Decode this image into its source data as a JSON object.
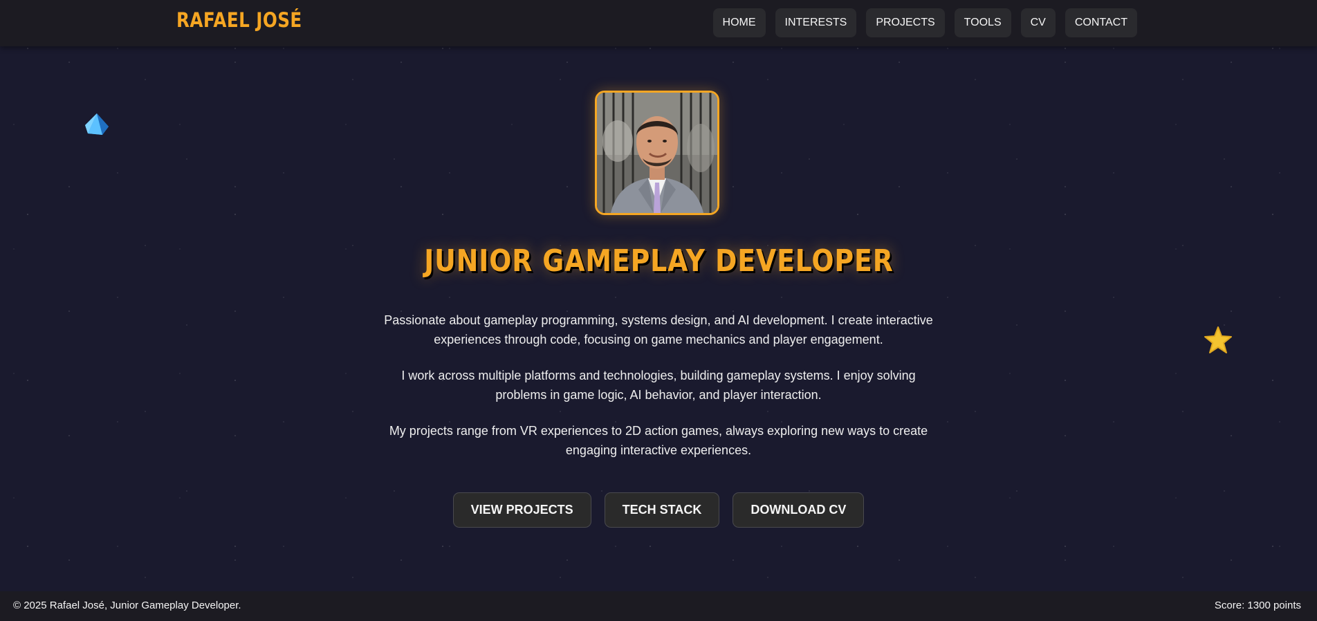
{
  "header": {
    "logo": "RAFAEL JOSÉ",
    "nav": [
      "HOME",
      "INTERESTS",
      "PROJECTS",
      "TOOLS",
      "CV",
      "CONTACT"
    ]
  },
  "hero": {
    "photo_icon": "profile-photo",
    "title": "JUNIOR GAMEPLAY DEVELOPER",
    "paragraphs": [
      "Passionate about gameplay programming, systems design, and AI development. I create interactive experiences through code, focusing on game mechanics and player engagement.",
      "I work across multiple platforms and technologies, building gameplay systems. I enjoy solving problems in game logic, AI behavior, and player interaction.",
      "My projects range from VR experiences to 2D action games, always exploring new ways to create engaging interactive experiences."
    ],
    "buttons": [
      "VIEW PROJECTS",
      "TECH STACK",
      "DOWNLOAD CV"
    ]
  },
  "collectibles": {
    "gem_icon": "gem-icon",
    "star_icon": "star-icon"
  },
  "footer": {
    "copyright": "© 2025 Rafael José, Junior Gameplay Developer.",
    "score": "Score: 1300 points"
  },
  "colors": {
    "accent": "#f5a623",
    "background": "#1a1a2e",
    "header": "#1c1b22",
    "button": "#2a2a2a",
    "gem": "#3aa8f0",
    "star": "#f4c430"
  }
}
